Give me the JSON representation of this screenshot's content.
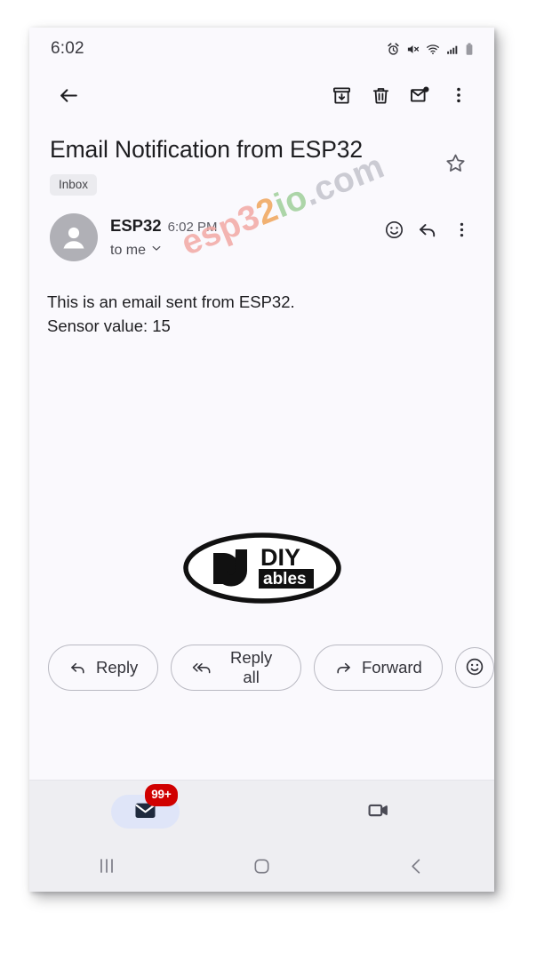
{
  "status_bar": {
    "time": "6:02",
    "icons": [
      "alarm-icon",
      "mute-icon",
      "wifi-icon",
      "signal-icon",
      "battery-icon"
    ]
  },
  "toolbar": {
    "back": "back-arrow-icon",
    "archive": "archive-icon",
    "delete": "trash-icon",
    "mark_unread": "mark-unread-icon",
    "more": "more-vert-icon"
  },
  "email": {
    "subject": "Email Notification from ESP32",
    "label_chip": "Inbox",
    "star": "star-outline-icon",
    "sender_name": "ESP32",
    "sender_time": "6:02 PM",
    "recipient": "to me",
    "body_line1": "This is an email sent from ESP32.",
    "body_line2": "Sensor value: 15",
    "actions_row": {
      "emoji": "emoji-smile-icon",
      "reply": "reply-arrow-icon",
      "more": "more-vert-icon"
    }
  },
  "watermark": {
    "part1": "esp3",
    "part2": "2",
    "part3": "io",
    "part4": ".com",
    "colors": {
      "part1": "#f2a9a4",
      "part2": "#f0a55a",
      "part3": "#9fcf9a",
      "part4": "#c3c4cc"
    }
  },
  "logo": {
    "name": "diyables-logo",
    "text_top": "DIY",
    "text_bottom": "ables"
  },
  "reply_actions": [
    {
      "label": "Reply",
      "icon": "reply-icon"
    },
    {
      "label": "Reply all",
      "icon": "reply-all-icon"
    },
    {
      "label": "Forward",
      "icon": "forward-icon"
    }
  ],
  "reply_emoji_button": "emoji-smile-icon",
  "bottom_nav": {
    "tabs": [
      {
        "name": "mail",
        "icon": "mail-filled-icon",
        "badge": "99+",
        "selected": true
      },
      {
        "name": "meet",
        "icon": "video-camera-icon",
        "badge": "",
        "selected": false
      }
    ]
  },
  "system_nav": {
    "recents": "recents-icon",
    "home": "home-icon",
    "back": "back-chevron-icon"
  },
  "colors": {
    "app_background": "#faf9fd",
    "bottom_bar": "#eeeef2",
    "badge_red": "#d00000",
    "tab_pill": "#dfe5f8",
    "mail_icon": "#1f2a3d"
  }
}
